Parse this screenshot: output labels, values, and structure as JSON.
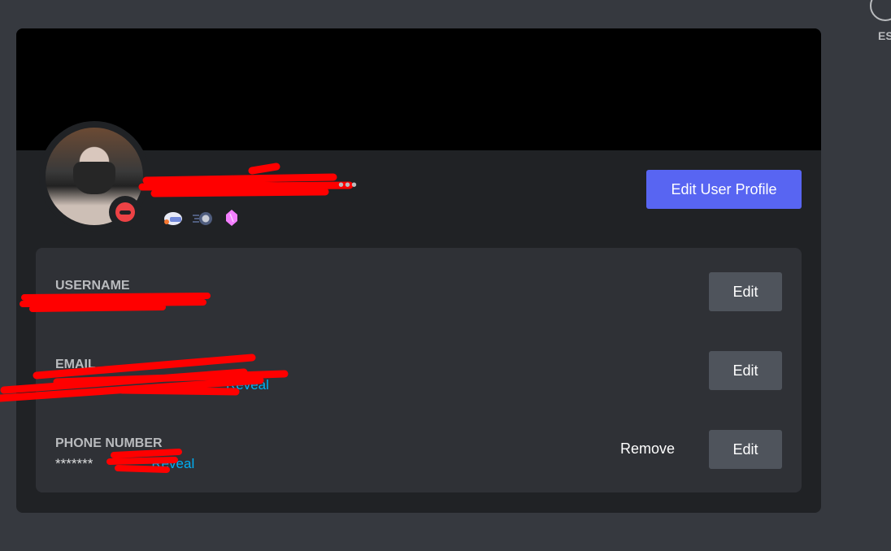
{
  "header": {
    "close_label": "ESC"
  },
  "profile": {
    "edit_profile_label": "Edit User Profile",
    "more_label": "•••",
    "status": "do-not-disturb",
    "badges": [
      "hypesquad-icon",
      "nitro-icon",
      "boost-gem-icon"
    ]
  },
  "account": {
    "username": {
      "label": "USERNAME",
      "edit": "Edit"
    },
    "email": {
      "label": "EMAIL",
      "reveal": "Reveal",
      "edit": "Edit"
    },
    "phone": {
      "label": "PHONE NUMBER",
      "masked": "*******",
      "reveal": "Reveal",
      "remove": "Remove",
      "edit": "Edit"
    }
  },
  "colors": {
    "accent": "#5865f2",
    "link": "#00aff4",
    "dnd": "#ed4245"
  }
}
